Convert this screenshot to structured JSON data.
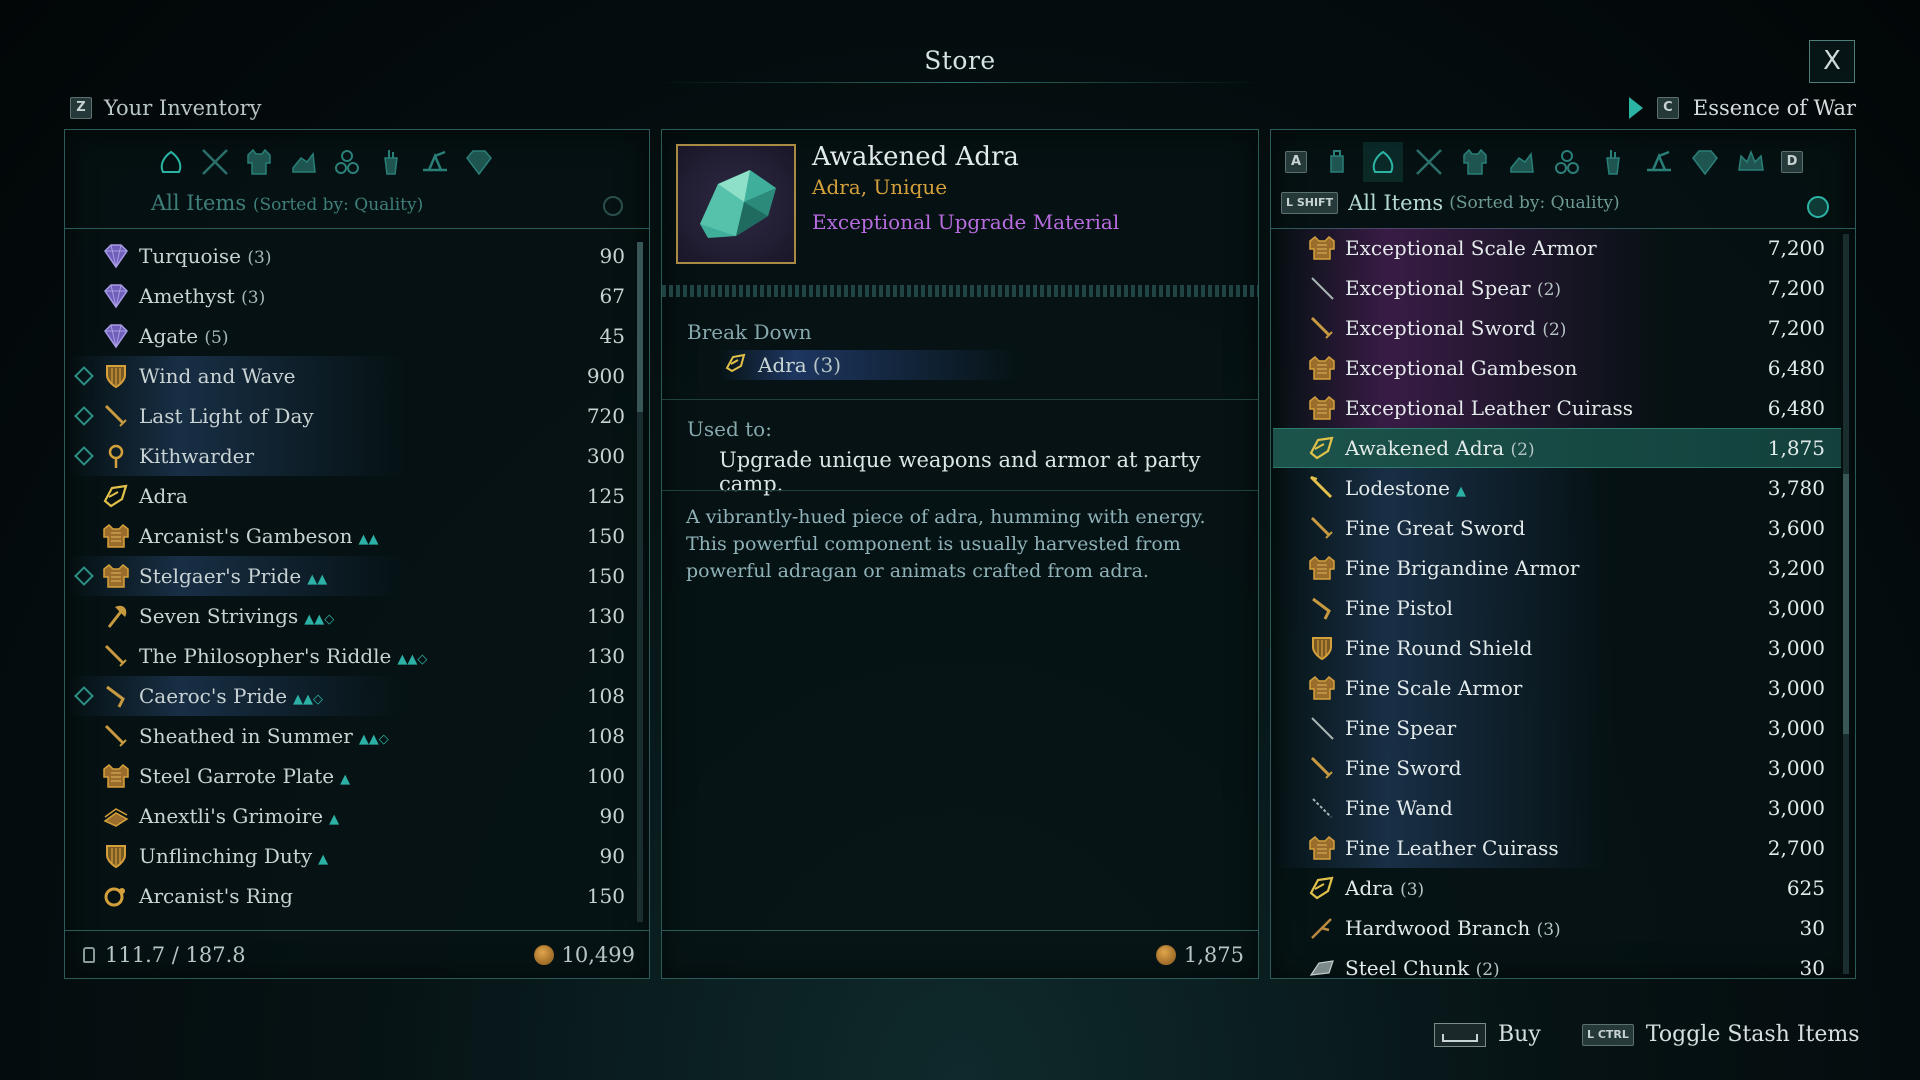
{
  "title": "Store",
  "close_label": "X",
  "left_header": {
    "key": "Z",
    "label": "Your Inventory"
  },
  "right_header": {
    "key": "C",
    "label": "Essence of War"
  },
  "left_panel": {
    "sort_label": "All Items",
    "sort_suffix": "(Sorted by: Quality)",
    "categories": [
      "all-items-icon",
      "weapons-icon",
      "armor-icon",
      "shield-icon",
      "accessories-icon",
      "consumables-icon",
      "ingredients-icon",
      "gems-icon"
    ],
    "items": [
      {
        "name": "Turquoise",
        "count": "(3)",
        "value": "90",
        "icon": "gem-icon",
        "fav": false,
        "badge": ""
      },
      {
        "name": "Amethyst",
        "count": "(3)",
        "value": "67",
        "icon": "gem-icon",
        "fav": false,
        "badge": ""
      },
      {
        "name": "Agate",
        "count": "(5)",
        "value": "45",
        "icon": "gem-icon",
        "fav": false,
        "badge": ""
      },
      {
        "name": "Wind and Wave",
        "count": "",
        "value": "900",
        "icon": "shield-icon",
        "fav": true,
        "badge": ""
      },
      {
        "name": "Last Light of Day",
        "count": "",
        "value": "720",
        "icon": "sword-icon",
        "fav": true,
        "badge": ""
      },
      {
        "name": "Kithwarder",
        "count": "",
        "value": "300",
        "icon": "amulet-icon",
        "fav": true,
        "badge": ""
      },
      {
        "name": "Adra",
        "count": "",
        "value": "125",
        "icon": "adra-icon",
        "fav": false,
        "badge": ""
      },
      {
        "name": "Arcanist's Gambeson",
        "count": "",
        "value": "150",
        "icon": "armor-icon",
        "fav": false,
        "badge": "▲▲"
      },
      {
        "name": "Stelgaer's Pride",
        "count": "",
        "value": "150",
        "icon": "armor-icon",
        "fav": true,
        "badge": "▲▲"
      },
      {
        "name": "Seven Strivings",
        "count": "",
        "value": "130",
        "icon": "axe-icon",
        "fav": false,
        "badge": "▲▲◇"
      },
      {
        "name": "The Philosopher's Riddle",
        "count": "",
        "value": "130",
        "icon": "sword-icon",
        "fav": false,
        "badge": "▲▲◇"
      },
      {
        "name": "Caeroc's Pride",
        "count": "",
        "value": "108",
        "icon": "pistol-icon",
        "fav": true,
        "badge": "▲▲◇"
      },
      {
        "name": "Sheathed in Summer",
        "count": "",
        "value": "108",
        "icon": "sword-icon",
        "fav": false,
        "badge": "▲▲◇"
      },
      {
        "name": "Steel Garrote Plate",
        "count": "",
        "value": "100",
        "icon": "armor-icon",
        "fav": false,
        "badge": "▲"
      },
      {
        "name": "Anextli's Grimoire",
        "count": "",
        "value": "90",
        "icon": "grimoire-icon",
        "fav": false,
        "badge": "▲"
      },
      {
        "name": "Unflinching Duty",
        "count": "",
        "value": "90",
        "icon": "shield-icon",
        "fav": false,
        "badge": "▲"
      },
      {
        "name": "Arcanist's Ring",
        "count": "",
        "value": "150",
        "icon": "ring-icon",
        "fav": false,
        "badge": ""
      }
    ],
    "weight": "111.7 / 187.8",
    "money": "10,499"
  },
  "detail": {
    "name": "Awakened Adra",
    "subtitle": "Adra, Unique",
    "type": "Exceptional Upgrade Material",
    "break_down_label": "Break Down",
    "break_down_item": "Adra",
    "break_down_count": "(3)",
    "used_to_label": "Used to:",
    "used_to_text": "Upgrade unique weapons and armor at party camp.",
    "description": "A vibrantly-hued piece of adra, humming with energy. This powerful component is usually harvested from powerful adragan or animats crafted from adra.",
    "price": "1,875"
  },
  "right_panel": {
    "key_left": "A",
    "key_right": "D",
    "shift_key": "L SHIFT",
    "sort_label": "All Items",
    "sort_suffix": "(Sorted by: Quality)",
    "categories": [
      "potion-icon",
      "all-items-icon",
      "weapons-icon",
      "armor-icon",
      "shield-icon",
      "accessories-icon",
      "consumables-icon",
      "ingredients-icon",
      "gems-icon",
      "crown-icon"
    ],
    "items": [
      {
        "name": "Exceptional Scale Armor",
        "count": "",
        "value": "7,200",
        "icon": "armor-icon",
        "style": "p"
      },
      {
        "name": "Exceptional Spear",
        "count": "(2)",
        "value": "7,200",
        "icon": "spear-icon",
        "style": "p"
      },
      {
        "name": "Exceptional Sword",
        "count": "(2)",
        "value": "7,200",
        "icon": "sword-icon",
        "style": "p"
      },
      {
        "name": "Exceptional Gambeson",
        "count": "",
        "value": "6,480",
        "icon": "armor-icon",
        "style": "p"
      },
      {
        "name": "Exceptional Leather Cuirass",
        "count": "",
        "value": "6,480",
        "icon": "armor-icon",
        "style": "p"
      },
      {
        "name": "Awakened Adra",
        "count": "(2)",
        "value": "1,875",
        "icon": "adra-icon",
        "style": "sel"
      },
      {
        "name": "Lodestone",
        "count": "",
        "value": "3,780",
        "icon": "lodestone-icon",
        "style": "b",
        "badge": "▲"
      },
      {
        "name": "Fine Great Sword",
        "count": "",
        "value": "3,600",
        "icon": "sword-icon",
        "style": "b"
      },
      {
        "name": "Fine Brigandine Armor",
        "count": "",
        "value": "3,200",
        "icon": "armor-icon",
        "style": "b"
      },
      {
        "name": "Fine Pistol",
        "count": "",
        "value": "3,000",
        "icon": "pistol-icon",
        "style": "b"
      },
      {
        "name": "Fine Round Shield",
        "count": "",
        "value": "3,000",
        "icon": "shield-icon",
        "style": "b"
      },
      {
        "name": "Fine Scale Armor",
        "count": "",
        "value": "3,000",
        "icon": "armor-icon",
        "style": "b"
      },
      {
        "name": "Fine Spear",
        "count": "",
        "value": "3,000",
        "icon": "spear-icon",
        "style": "b"
      },
      {
        "name": "Fine Sword",
        "count": "",
        "value": "3,000",
        "icon": "sword-icon",
        "style": "b"
      },
      {
        "name": "Fine Wand",
        "count": "",
        "value": "3,000",
        "icon": "wand-icon",
        "style": "b"
      },
      {
        "name": "Fine Leather Cuirass",
        "count": "",
        "value": "2,700",
        "icon": "armor-icon",
        "style": "b"
      },
      {
        "name": "Adra",
        "count": "(3)",
        "value": "625",
        "icon": "adra-icon",
        "style": ""
      },
      {
        "name": "Hardwood Branch",
        "count": "(3)",
        "value": "30",
        "icon": "branch-icon",
        "style": ""
      },
      {
        "name": "Steel Chunk",
        "count": "(2)",
        "value": "30",
        "icon": "chunk-icon",
        "style": ""
      }
    ]
  },
  "hints": {
    "buy_label": "Buy",
    "toggle_key": "L CTRL",
    "toggle_label": "Toggle Stash Items"
  },
  "colors": {
    "accent": "#2bb3a3",
    "unique": "#d4a03c",
    "exceptional": "#b86ce0",
    "panel_border": "#2b5b59"
  }
}
